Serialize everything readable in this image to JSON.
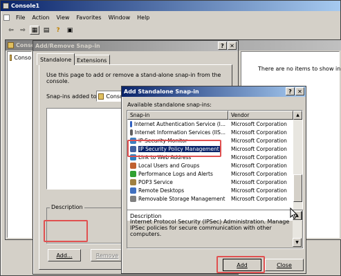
{
  "console": {
    "title": "Console1",
    "menu": [
      "File",
      "Action",
      "View",
      "Favorites",
      "Window",
      "Help"
    ],
    "inner_title": "Conso",
    "tree_item": "Conso",
    "empty_text": "There are no items to show in this v"
  },
  "add_remove": {
    "title": "Add/Remove Snap-in",
    "tabs": [
      "Standalone",
      "Extensions"
    ],
    "intro": "Use this page to add or remove a stand-alone snap-in from the console.",
    "snapins_label": "Snap-ins added to:",
    "snapins_value": "Conso",
    "description_label": "Description",
    "add_button": "Add...",
    "remove_button": "Remove"
  },
  "standalone": {
    "title": "Add Standalone Snap-in",
    "list_label": "Available standalone snap-ins:",
    "columns": [
      "Snap-in",
      "Vendor"
    ],
    "rows": [
      {
        "name": "Internet Authentication Service (I...",
        "vendor": "Microsoft Corporation",
        "icon": "ias-icon",
        "color": "#3060c0"
      },
      {
        "name": "Internet Information Services (IIS...",
        "vendor": "Microsoft Corporation",
        "icon": "iis-icon",
        "color": "#606060"
      },
      {
        "name": "IP Security Monitor",
        "vendor": "Microsoft Corporation",
        "icon": "ipsec-monitor-icon",
        "color": "#4080c0"
      },
      {
        "name": "IP Security Policy Management",
        "vendor": "Microsoft Corporation",
        "icon": "ipsec-policy-icon",
        "color": "#4060a0",
        "selected": true
      },
      {
        "name": "Link to Web Address",
        "vendor": "Microsoft Corporation",
        "icon": "link-icon",
        "color": "#3080c0"
      },
      {
        "name": "Local Users and Groups",
        "vendor": "Microsoft Corporation",
        "icon": "users-icon",
        "color": "#c06030"
      },
      {
        "name": "Performance Logs and Alerts",
        "vendor": "Microsoft Corporation",
        "icon": "perf-icon",
        "color": "#30a030"
      },
      {
        "name": "POP3 Service",
        "vendor": "Microsoft Corporation",
        "icon": "pop3-icon",
        "color": "#a08040"
      },
      {
        "name": "Remote Desktops",
        "vendor": "Microsoft Corporation",
        "icon": "remote-desktop-icon",
        "color": "#4070c0"
      },
      {
        "name": "Removable Storage Management",
        "vendor": "Microsoft Corporation",
        "icon": "storage-icon",
        "color": "#808080"
      }
    ],
    "description_label": "Description",
    "description_text": "Internet Protocol Security (IPSec) Administration. Manage IPSec policies for secure communication with other computers.",
    "add_button": "Add",
    "close_button": "Close"
  },
  "colors": {
    "highlight": "#e05050",
    "selection": "#0a246a",
    "desktop": "#3a6ea5"
  }
}
